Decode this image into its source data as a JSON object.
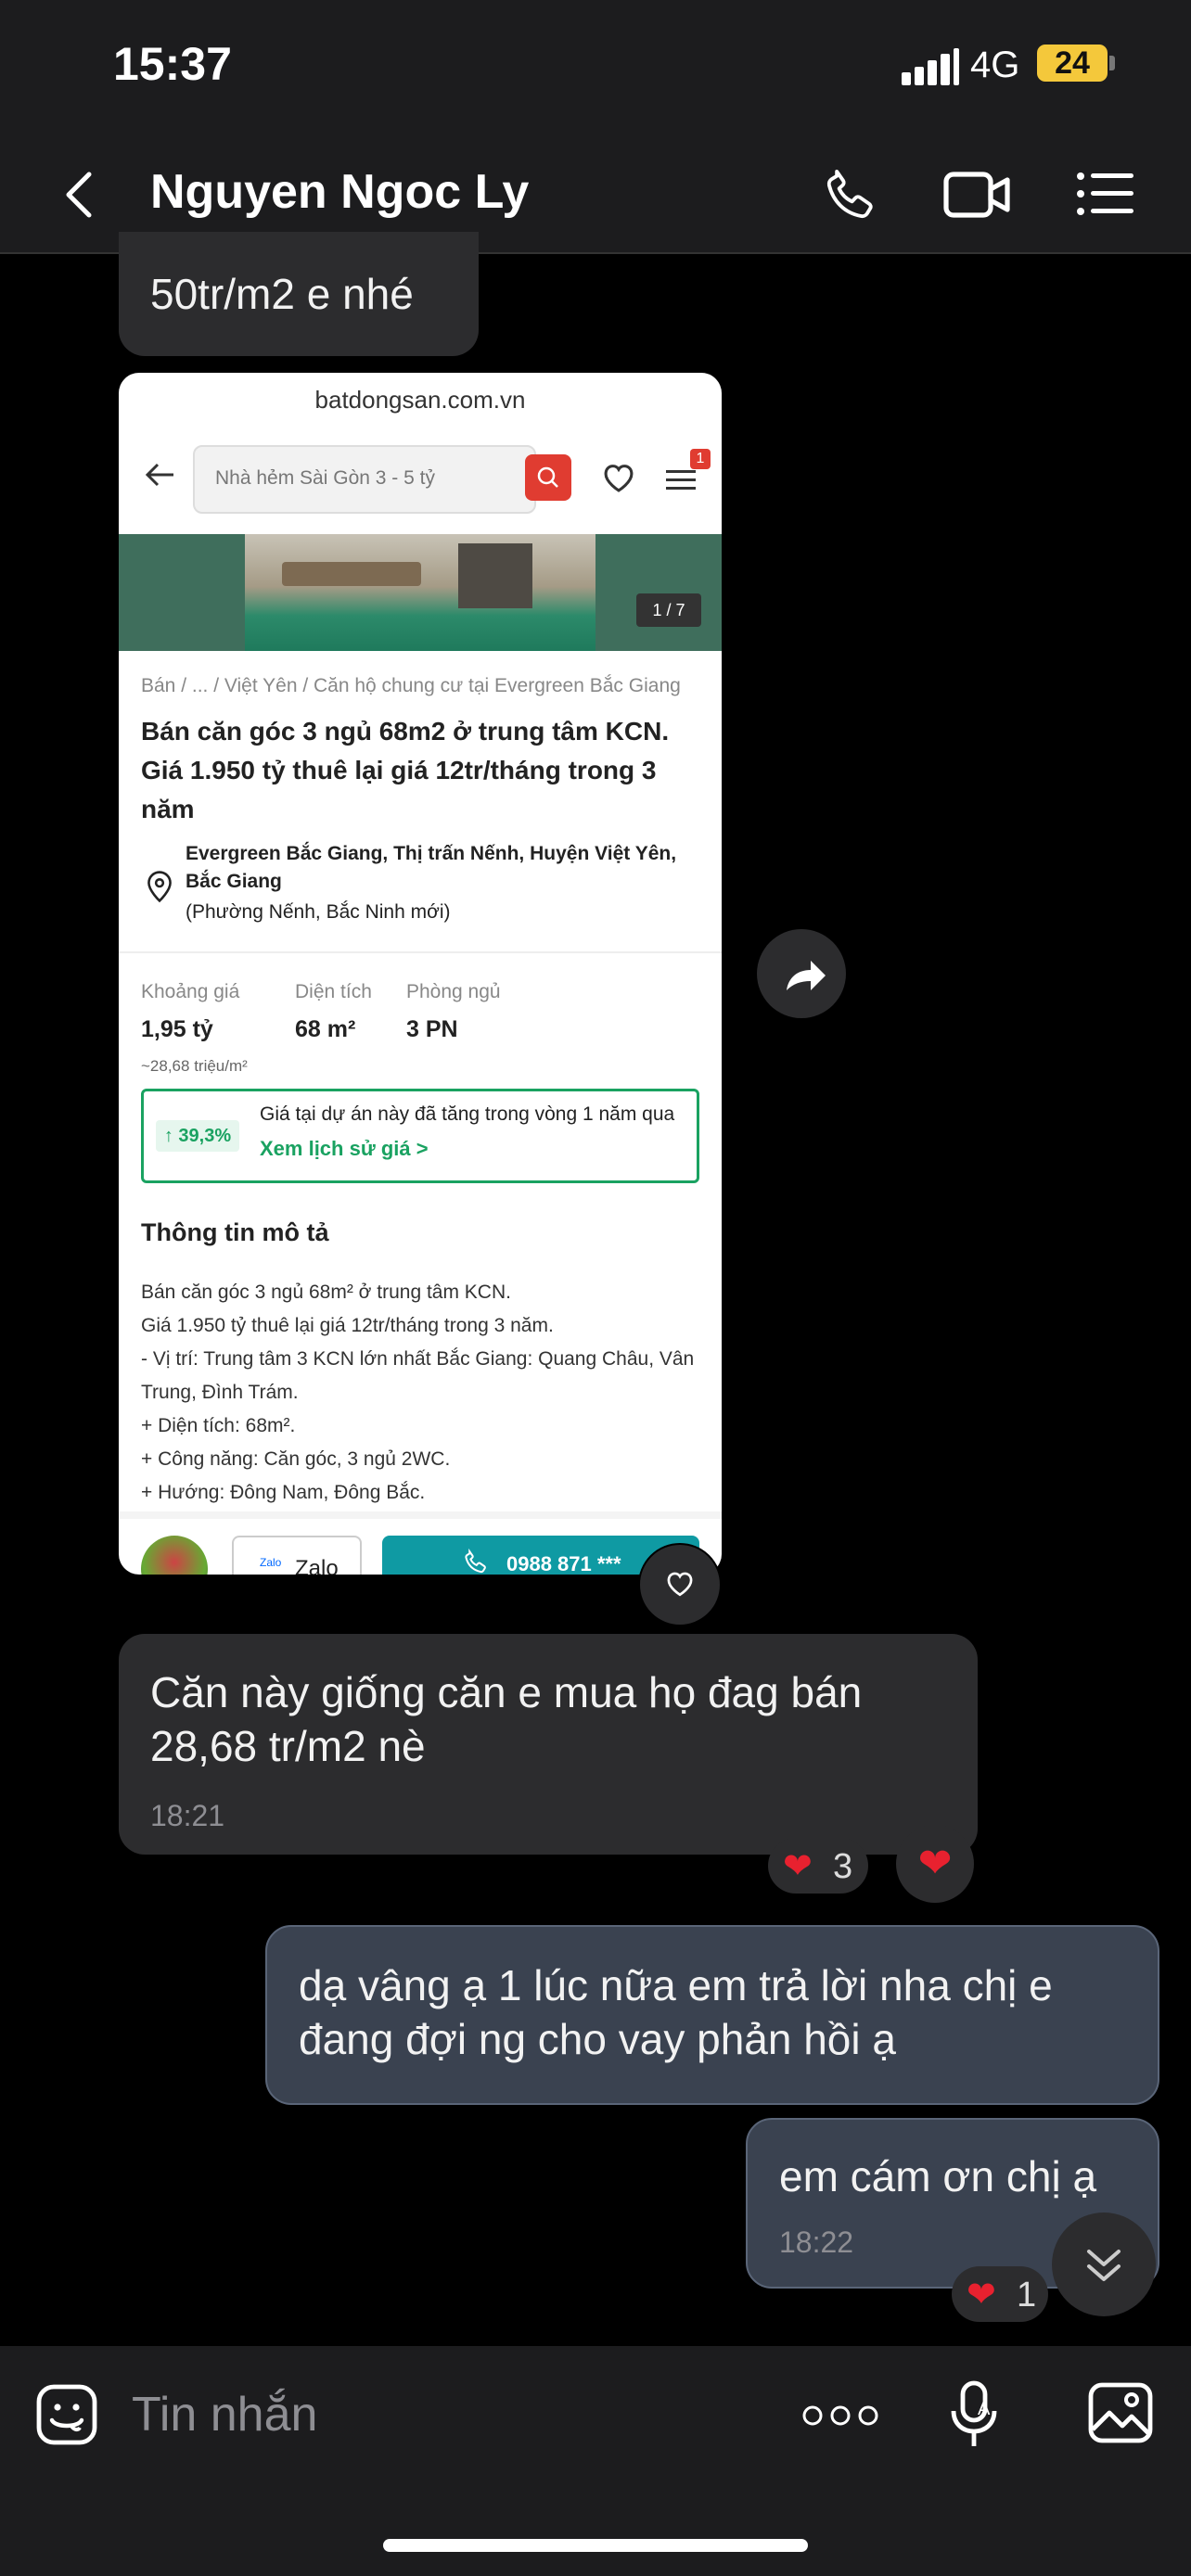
{
  "status": {
    "time": "15:37",
    "network": "4G",
    "battery": "24"
  },
  "header": {
    "contact_name": "Nguyen Ngoc Ly"
  },
  "messages": {
    "m1": {
      "text": "50tr/m2 e nhé"
    },
    "m2": {
      "text": "Căn này giống căn e mua họ đag bán 28,68 tr/m2 nè",
      "time": "18:21"
    },
    "m3": {
      "text": "dạ vâng ạ 1 lúc nữa em trả lời nha chị e đang đợi ng cho vay phản hồi ạ"
    },
    "m4": {
      "text": "em cám ơn chị ạ",
      "time": "18:22"
    }
  },
  "reactions": {
    "m2_count": "3",
    "m4_count": "1"
  },
  "card": {
    "url": "batdongsan.com.vn",
    "search_placeholder": "Nhà hẻm Sài Gòn 3 - 5 tỷ",
    "menu_badge": "1",
    "image_counter": "1 / 7",
    "breadcrumb": "Bán / ... / Việt Yên / Căn hộ chung cư tại Evergreen Bắc Giang",
    "title": "Bán căn góc 3 ngủ 68m2 ở trung tâm KCN. Giá 1.950 tỷ thuê lại giá 12tr/tháng trong 3 năm",
    "address": "Evergreen Bắc Giang, Thị trấn Nếnh, Huyện Việt Yên, Bắc Giang",
    "address_sub": "(Phường Nếnh, Bắc Ninh mới)",
    "price_label": "Khoảng giá",
    "price_value": "1,95 tỷ",
    "price_per_m2": "~28,68 triệu/m²",
    "area_label": "Diện tích",
    "area_value": "68 m²",
    "bed_label": "Phòng ngủ",
    "bed_value": "3 PN",
    "growth_pct": "↑ 39,3%",
    "growth_text": "Giá tại dự án này đã tăng trong vòng 1 năm qua",
    "growth_link": "Xem lịch sử giá >",
    "desc_title": "Thông tin mô tả",
    "desc_lines": [
      "Bán căn góc 3 ngủ 68m² ở trung tâm KCN.",
      "Giá 1.950 tỷ thuê lại giá 12tr/tháng trong 3 năm.",
      "- Vị trí: Trung tâm 3 KCN lớn nhất Bắc Giang: Quang Châu, Vân",
      "Trung, Đình Trám.",
      "+ Diện tích: 68m².",
      "+ Công năng: Căn góc, 3 ngủ 2WC.",
      "+ Hướng: Đông Nam, Đông Bắc."
    ],
    "zalo_small": "Zalo",
    "zalo_label": "Zalo",
    "phone": "0988 871 ***"
  },
  "composer": {
    "placeholder": "Tin nhắn"
  },
  "colors": {
    "accent_green": "#1aa261",
    "accent_red": "#e03c31",
    "teal": "#0f9aa3",
    "heart": "#e8212f"
  }
}
